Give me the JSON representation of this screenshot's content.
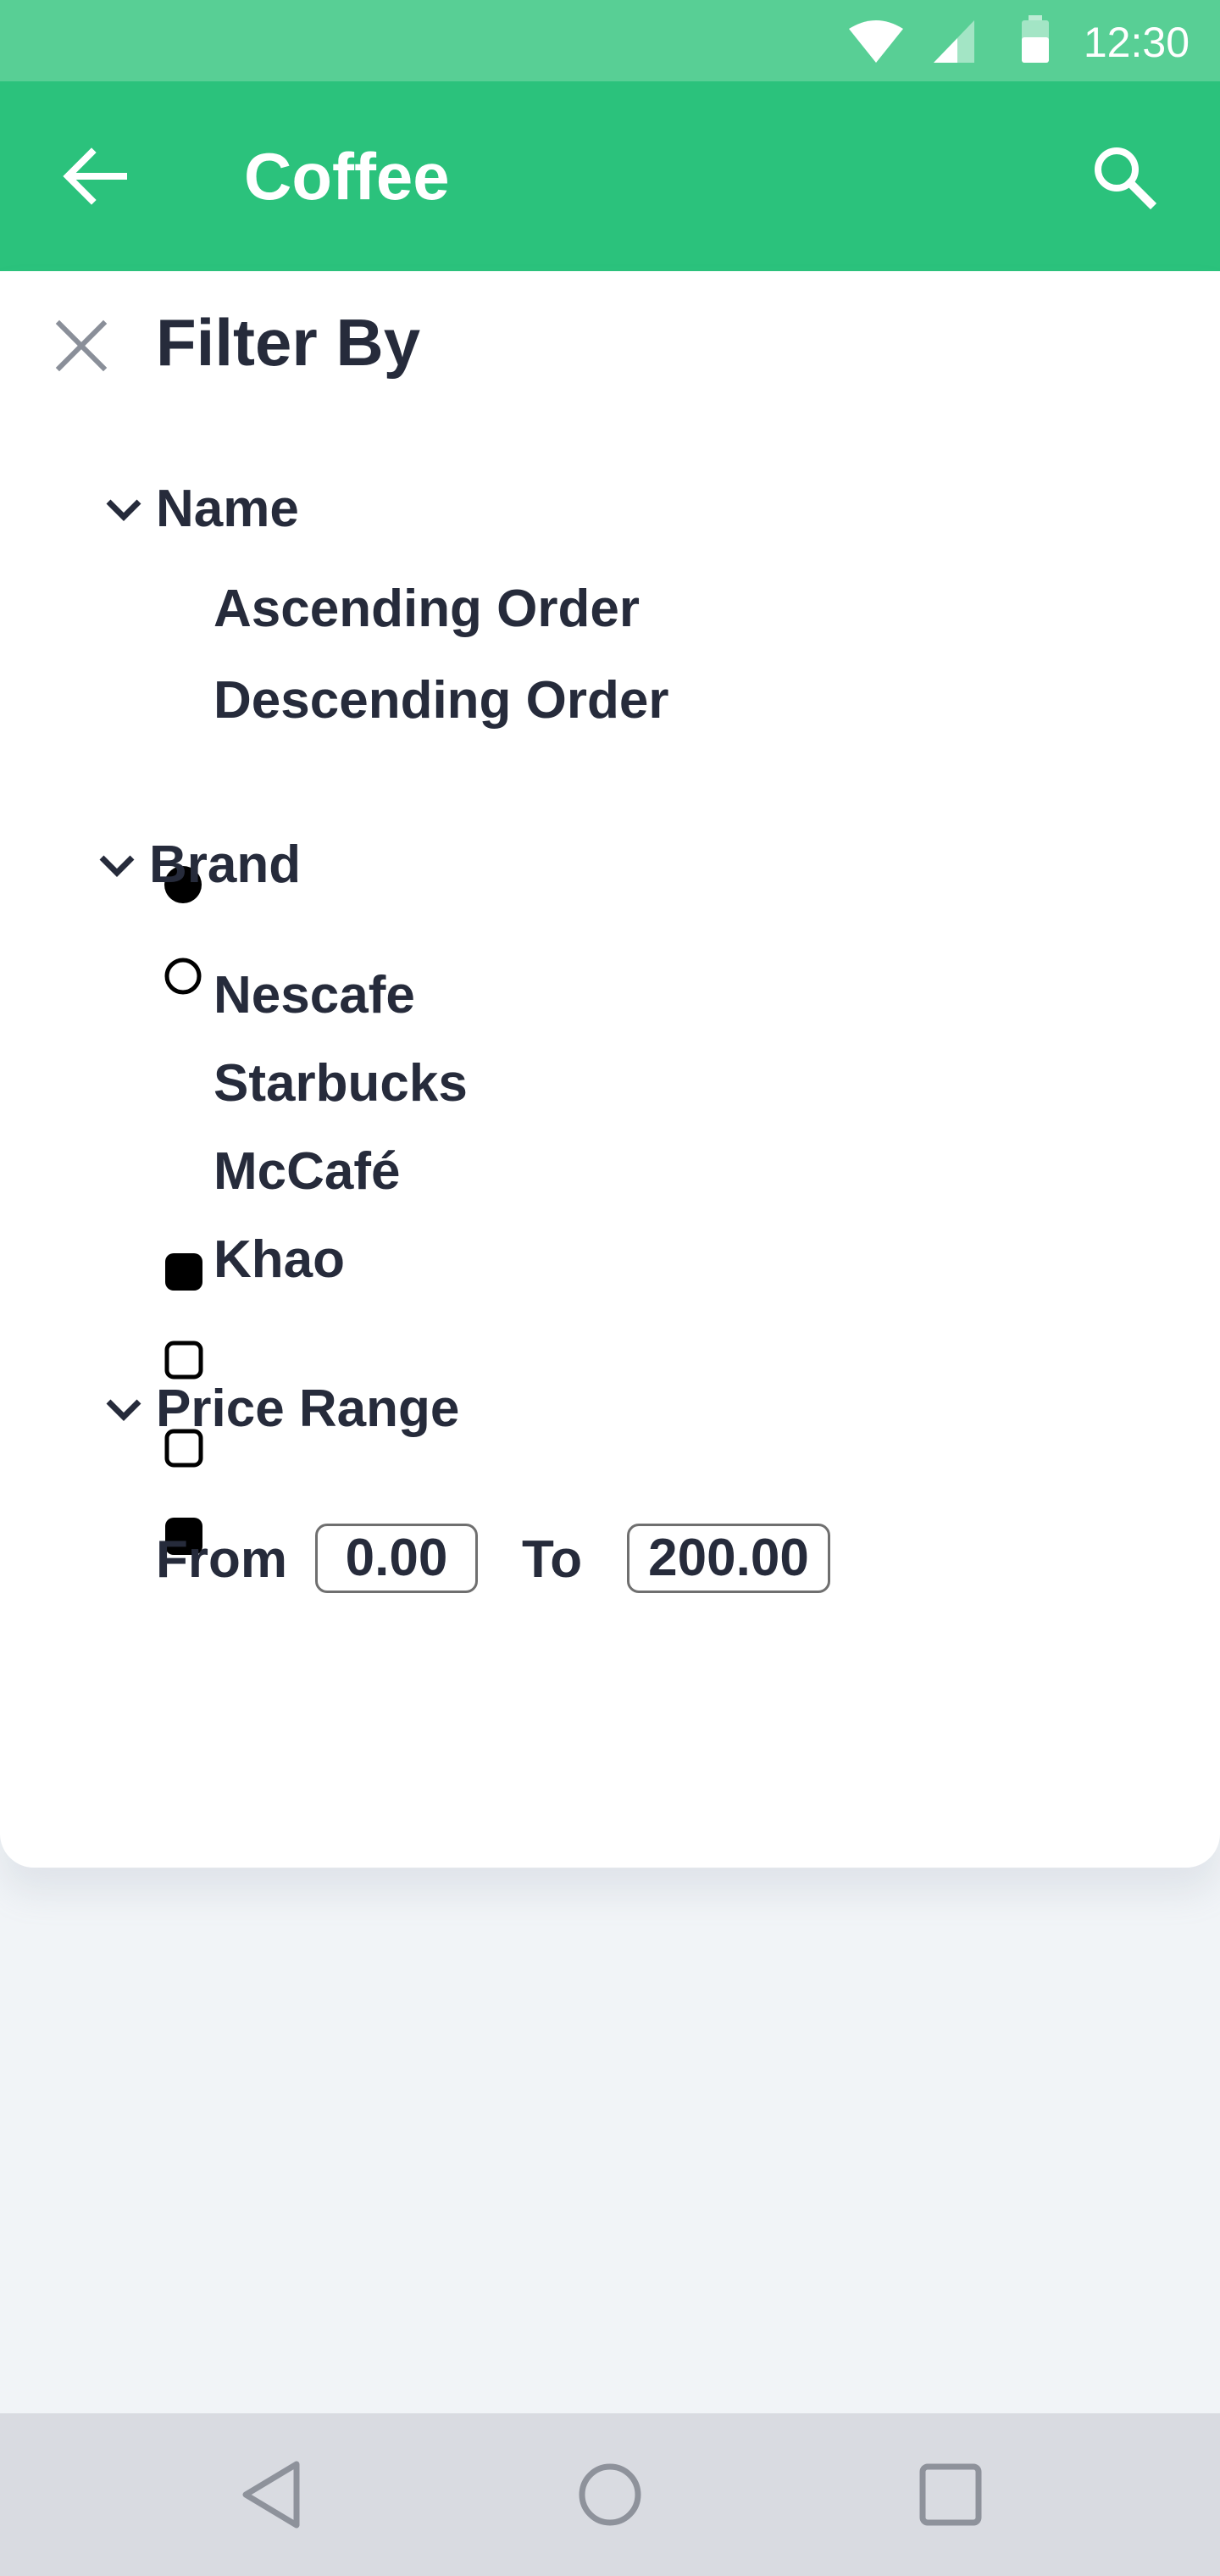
{
  "status_bar": {
    "time": "12:30",
    "icons": [
      "wifi-icon",
      "signal-icon",
      "battery-icon"
    ]
  },
  "app_bar": {
    "title": "Coffee",
    "back_icon": "arrow-left-icon",
    "search_icon": "search-icon"
  },
  "filter": {
    "title": "Filter By",
    "close_icon": "close-icon",
    "sections": {
      "name": {
        "label": "Name",
        "options": [
          {
            "label": "Ascending Order",
            "selected": true
          },
          {
            "label": "Descending Order",
            "selected": false
          }
        ]
      },
      "brand": {
        "label": "Brand",
        "options": [
          {
            "label": "Nescafe",
            "checked": true
          },
          {
            "label": "Starbucks",
            "checked": false
          },
          {
            "label": "McCafé",
            "checked": false
          },
          {
            "label": "Khao",
            "checked": true
          }
        ]
      },
      "price": {
        "label": "Price Range",
        "from_label": "From",
        "from_value": "0.00",
        "to_label": "To",
        "to_value": "200.00"
      }
    }
  },
  "colors": {
    "status_bar": "#58cf95",
    "app_bar": "#2bc27c",
    "text": "#262b3b",
    "background": "#f1f4f7",
    "nav_bar": "#d9dbe1"
  },
  "nav_bar": {
    "icons": [
      "back-triangle-icon",
      "home-circle-icon",
      "recents-square-icon"
    ]
  }
}
